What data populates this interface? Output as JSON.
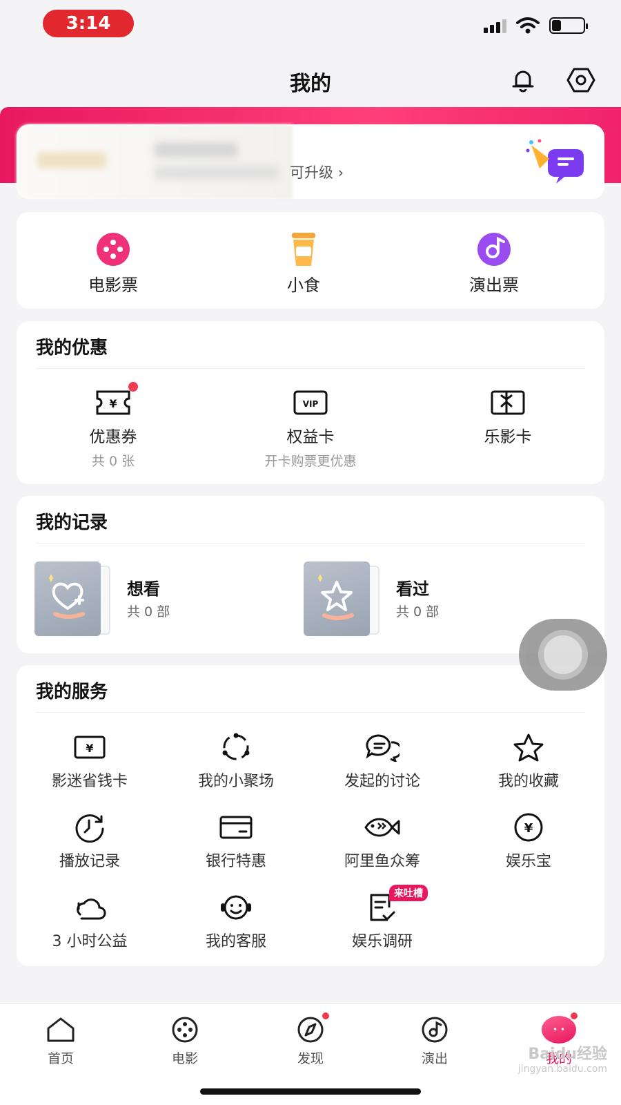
{
  "status_bar": {
    "time": "3:14"
  },
  "header": {
    "title": "我的"
  },
  "member": {
    "upgrade_text": "可升级 ›"
  },
  "tickets": [
    {
      "label": "电影票",
      "icon": "film-reel-icon"
    },
    {
      "label": "小食",
      "icon": "drink-cup-icon"
    },
    {
      "label": "演出票",
      "icon": "music-disc-icon"
    }
  ],
  "coupons": {
    "title": "我的优惠",
    "items": [
      {
        "label": "优惠券",
        "sub": "共 0 张",
        "icon": "coupon-icon"
      },
      {
        "label": "权益卡",
        "sub": "开卡购票更优惠",
        "icon": "vip-card-icon",
        "icon_text": "VIP"
      },
      {
        "label": "乐影卡",
        "sub": "",
        "icon": "gift-card-icon"
      }
    ]
  },
  "records": {
    "title": "我的记录",
    "items": [
      {
        "label": "想看",
        "count": "共 0 部",
        "icon": "heart-plus-icon"
      },
      {
        "label": "看过",
        "count": "共 0 部",
        "icon": "star-icon"
      }
    ]
  },
  "services": {
    "title": "我的服务",
    "items": [
      {
        "label": "影迷省钱卡",
        "icon": "yen-card-icon"
      },
      {
        "label": "我的小聚场",
        "icon": "circle-dots-icon"
      },
      {
        "label": "发起的讨论",
        "icon": "chat-bubbles-icon"
      },
      {
        "label": "我的收藏",
        "icon": "star-outline-icon"
      },
      {
        "label": "播放记录",
        "icon": "clock-icon"
      },
      {
        "label": "银行特惠",
        "icon": "bank-card-icon"
      },
      {
        "label": "阿里鱼众筹",
        "icon": "fish-icon"
      },
      {
        "label": "娱乐宝",
        "icon": "yen-circle-icon"
      },
      {
        "label": "3 小时公益",
        "icon": "cloud-heart-icon"
      },
      {
        "label": "我的客服",
        "icon": "headset-smile-icon"
      },
      {
        "label": "娱乐调研",
        "icon": "survey-icon",
        "badge": "来吐槽"
      }
    ]
  },
  "tabbar": {
    "tabs": [
      {
        "label": "首页",
        "icon": "home-icon"
      },
      {
        "label": "电影",
        "icon": "film-icon"
      },
      {
        "label": "发现",
        "icon": "compass-icon"
      },
      {
        "label": "演出",
        "icon": "music-note-icon"
      },
      {
        "label": "我的",
        "icon": "me-icon"
      }
    ]
  },
  "watermark": {
    "brand": "Baidu经验",
    "url": "jingyan.baidu.com"
  },
  "colors": {
    "accent": "#e8185f",
    "time_pill": "#e0282e",
    "red_dot": "#f03a4f"
  }
}
